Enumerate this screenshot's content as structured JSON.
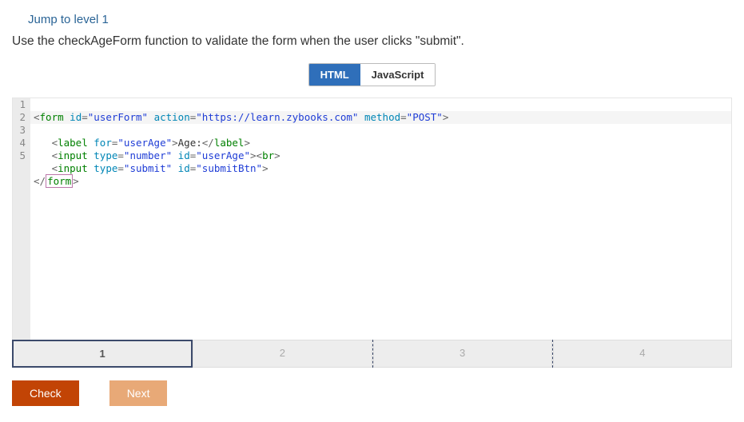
{
  "topLink": "Jump to level 1",
  "instruction": "Use the checkAgeForm function to validate the form when the user clicks \"submit\".",
  "tabs": {
    "html": "HTML",
    "js": "JavaScript"
  },
  "code": {
    "lines": [
      1,
      2,
      3,
      4,
      5
    ],
    "l1_form": "form",
    "l1_id_k": "id",
    "l1_id_v": "\"userForm\"",
    "l1_ac_k": "action",
    "l1_ac_v": "\"https://learn.zybooks.com\"",
    "l1_me_k": "method",
    "l1_me_v": "\"POST\"",
    "l2_label": "label",
    "l2_for_k": "for",
    "l2_for_v": "\"userAge\"",
    "l2_text": "Age:",
    "l3_input": "input",
    "l3_ty_k": "type",
    "l3_ty_v": "\"number\"",
    "l3_id_k": "id",
    "l3_id_v": "\"userAge\"",
    "l3_br": "br",
    "l4_input": "input",
    "l4_ty_k": "type",
    "l4_ty_v": "\"submit\"",
    "l4_id_k": "id",
    "l4_id_v": "\"submitBtn\"",
    "l5_form": "form"
  },
  "steps": {
    "s1": "1",
    "s2": "2",
    "s3": "3",
    "s4": "4"
  },
  "buttons": {
    "check": "Check",
    "next": "Next"
  }
}
